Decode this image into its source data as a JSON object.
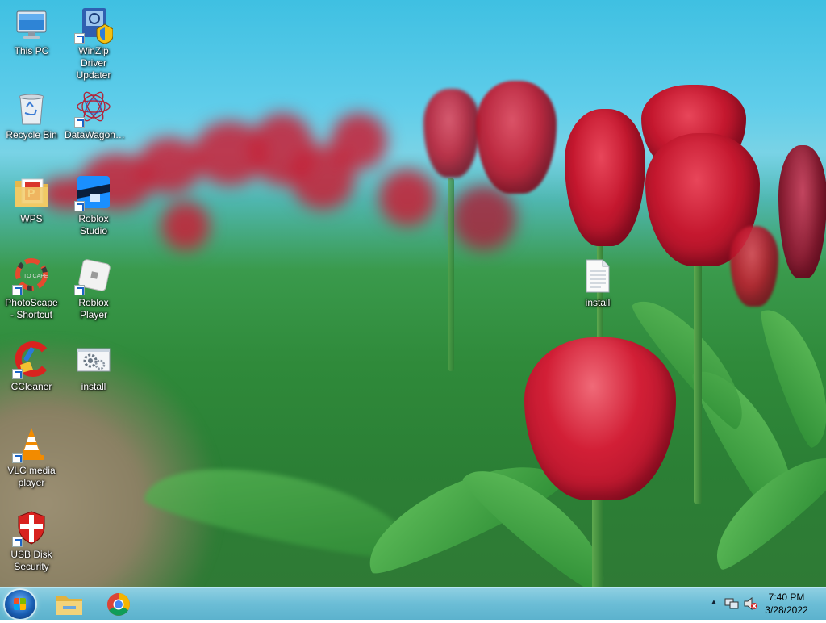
{
  "desktop": {
    "icons": [
      {
        "label": "This PC",
        "icon": "computer-icon",
        "shortcut": false
      },
      {
        "label": "WinZip Driver Updater",
        "icon": "winzip-driver-updater-icon",
        "shortcut": true
      },
      {
        "label": "Recycle Bin",
        "icon": "recycle-bin-icon",
        "shortcut": false
      },
      {
        "label": "DataWagon…",
        "icon": "datawagon-icon",
        "shortcut": true
      },
      {
        "label": "WPS",
        "icon": "folder-icon",
        "shortcut": false
      },
      {
        "label": "Roblox Studio",
        "icon": "roblox-studio-icon",
        "shortcut": true
      },
      {
        "label": "PhotoScape - Shortcut",
        "icon": "photoscape-icon",
        "shortcut": true
      },
      {
        "label": "Roblox Player",
        "icon": "roblox-player-icon",
        "shortcut": true
      },
      {
        "label": "CCleaner",
        "icon": "ccleaner-icon",
        "shortcut": true
      },
      {
        "label": "install",
        "icon": "settings-file-icon",
        "shortcut": false
      },
      {
        "label": "VLC media player",
        "icon": "vlc-icon",
        "shortcut": true
      },
      {
        "label": "USB Disk Security",
        "icon": "shield-icon",
        "shortcut": true
      },
      {
        "label": "install",
        "icon": "text-file-icon",
        "shortcut": false
      }
    ]
  },
  "taskbar": {
    "start_icon": "windows-start-icon",
    "pinned": [
      {
        "name": "File Explorer",
        "icon": "file-explorer-icon"
      },
      {
        "name": "Google Chrome",
        "icon": "chrome-icon"
      }
    ],
    "tray": {
      "show_hidden_icon": "chevron-up-icon",
      "network_icon": "network-icon",
      "volume_icon": "volume-muted-icon"
    },
    "clock": {
      "time": "7:40 PM",
      "date": "3/28/2022"
    }
  },
  "colors": {
    "sky": "#4fc3e4",
    "tulip": "#c5182f",
    "taskbar": "#6bbdd6"
  }
}
